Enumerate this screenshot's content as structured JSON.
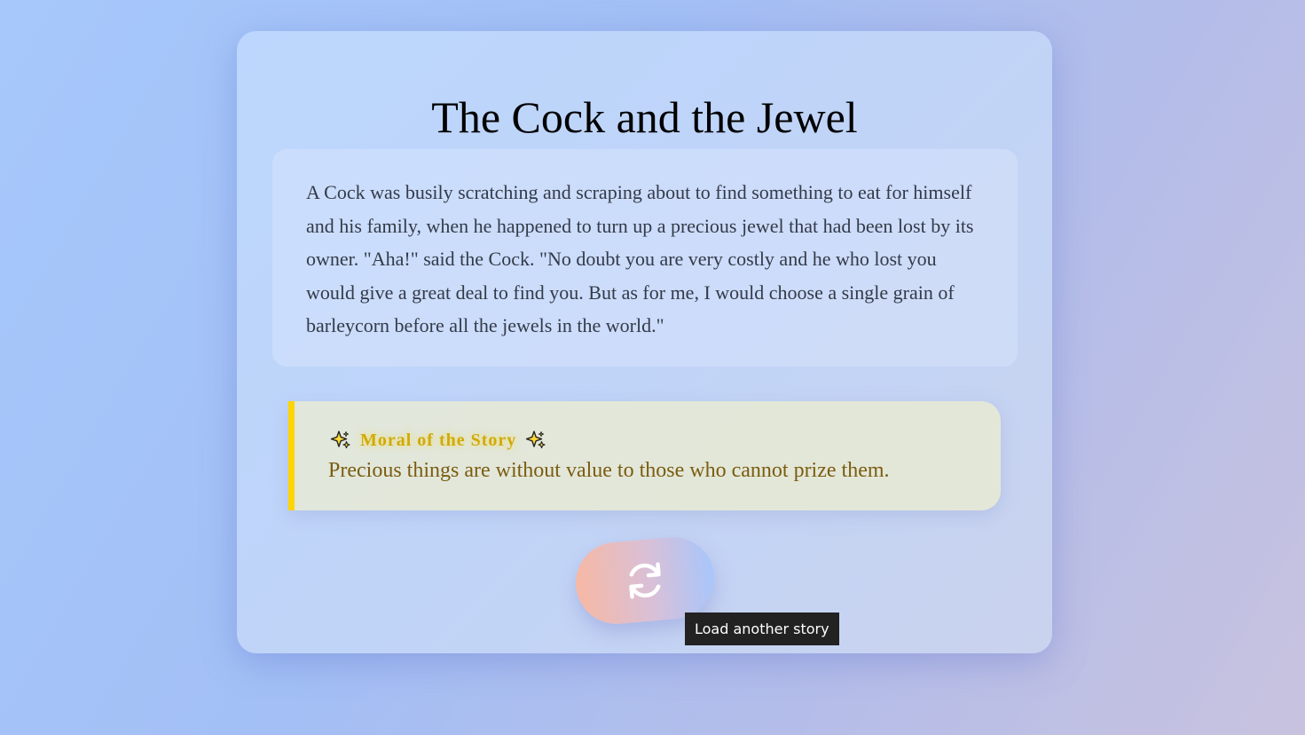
{
  "story": {
    "title": "The Cock and the Jewel",
    "body": "A Cock was busily scratching and scraping about to find something to eat for himself and his family, when he happened to turn up a precious jewel that had been lost by its owner. \"Aha!\" said the Cock. \"No doubt you are very costly and he who lost you would give a great deal to find you. But as for me, I would choose a single grain of barleycorn before all the jewels in the world.\""
  },
  "moral": {
    "heading": "Moral of the Story",
    "heading_icon": "sparkles-icon",
    "text": "Precious things are without value to those who cannot prize them.",
    "accent_color": "#ffd500"
  },
  "reload_button": {
    "icon": "refresh-icon",
    "tooltip": "Load another story"
  }
}
